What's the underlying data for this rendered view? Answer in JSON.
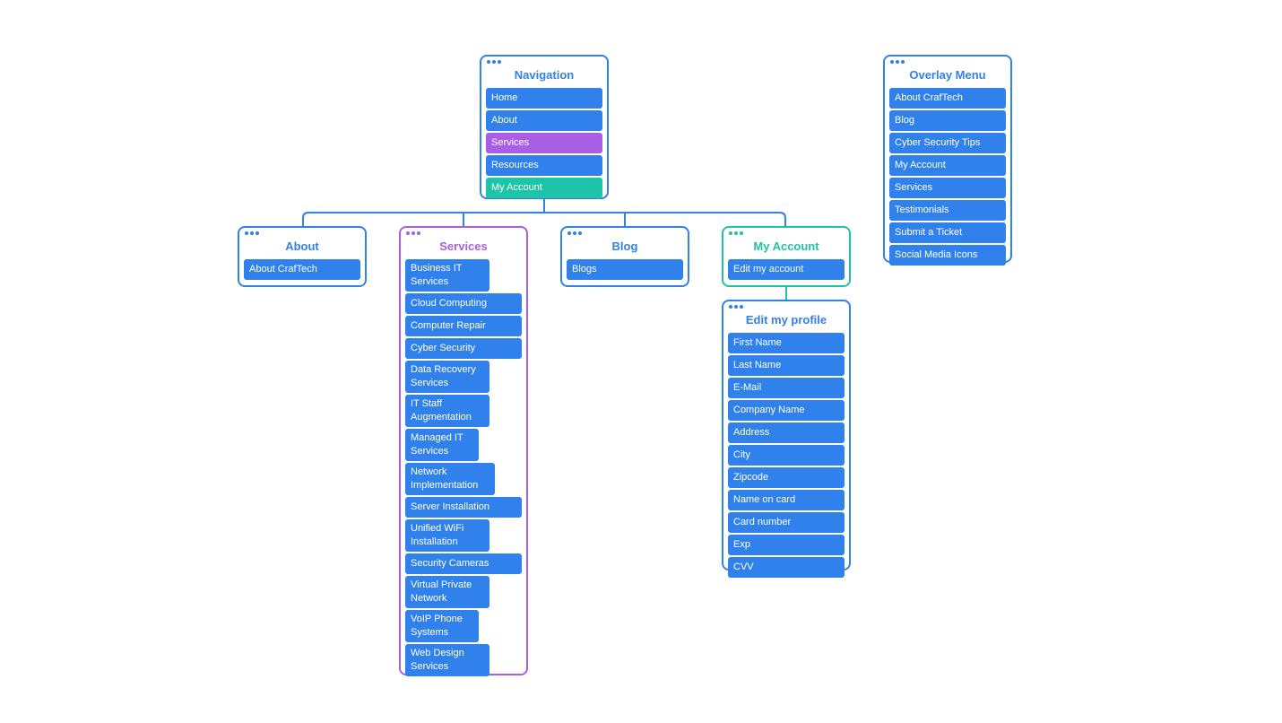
{
  "colors": {
    "blue": "#3081ec",
    "purple": "#a95ee6",
    "teal": "#22c1a6"
  },
  "navigation": {
    "title": "Navigation",
    "items": [
      {
        "label": "Home",
        "color": "blue"
      },
      {
        "label": "About",
        "color": "blue"
      },
      {
        "label": "Services",
        "color": "purple"
      },
      {
        "label": "Resources",
        "color": "blue"
      },
      {
        "label": "My Account",
        "color": "teal"
      }
    ]
  },
  "about": {
    "title": "About",
    "items": [
      {
        "label": "About CrafTech"
      }
    ]
  },
  "services": {
    "title": "Services",
    "items": [
      {
        "label": "Business IT Services"
      },
      {
        "label": "Cloud Computing"
      },
      {
        "label": "Computer Repair"
      },
      {
        "label": "Cyber Security"
      },
      {
        "label": "Data Recovery Services"
      },
      {
        "label": "IT Staff Augmentation"
      },
      {
        "label": "Managed IT Services"
      },
      {
        "label": "Network Implementation"
      },
      {
        "label": "Server Installation"
      },
      {
        "label": "Unified WiFi Installation"
      },
      {
        "label": "Security Cameras"
      },
      {
        "label": "Virtual Private Network"
      },
      {
        "label": "VoIP Phone Systems"
      },
      {
        "label": "Web Design Services"
      }
    ]
  },
  "blog": {
    "title": "Blog",
    "items": [
      {
        "label": "Blogs"
      }
    ]
  },
  "my_account": {
    "title": "My Account",
    "items": [
      {
        "label": "Edit my account"
      }
    ]
  },
  "edit_profile": {
    "title": "Edit my profile",
    "items": [
      {
        "label": "First Name"
      },
      {
        "label": "Last Name"
      },
      {
        "label": "E-Mail"
      },
      {
        "label": "Company Name"
      },
      {
        "label": "Address"
      },
      {
        "label": "City"
      },
      {
        "label": "Zipcode"
      },
      {
        "label": "Name on card"
      },
      {
        "label": "Card number"
      },
      {
        "label": "Exp"
      },
      {
        "label": "CVV"
      }
    ]
  },
  "overlay_menu": {
    "title": "Overlay Menu",
    "items": [
      {
        "label": "About CrafTech"
      },
      {
        "label": "Blog"
      },
      {
        "label": "Cyber Security Tips"
      },
      {
        "label": "My Account"
      },
      {
        "label": "Services"
      },
      {
        "label": "Testimonials"
      },
      {
        "label": "Submit a Ticket"
      },
      {
        "label": "Social Media Icons"
      }
    ]
  }
}
